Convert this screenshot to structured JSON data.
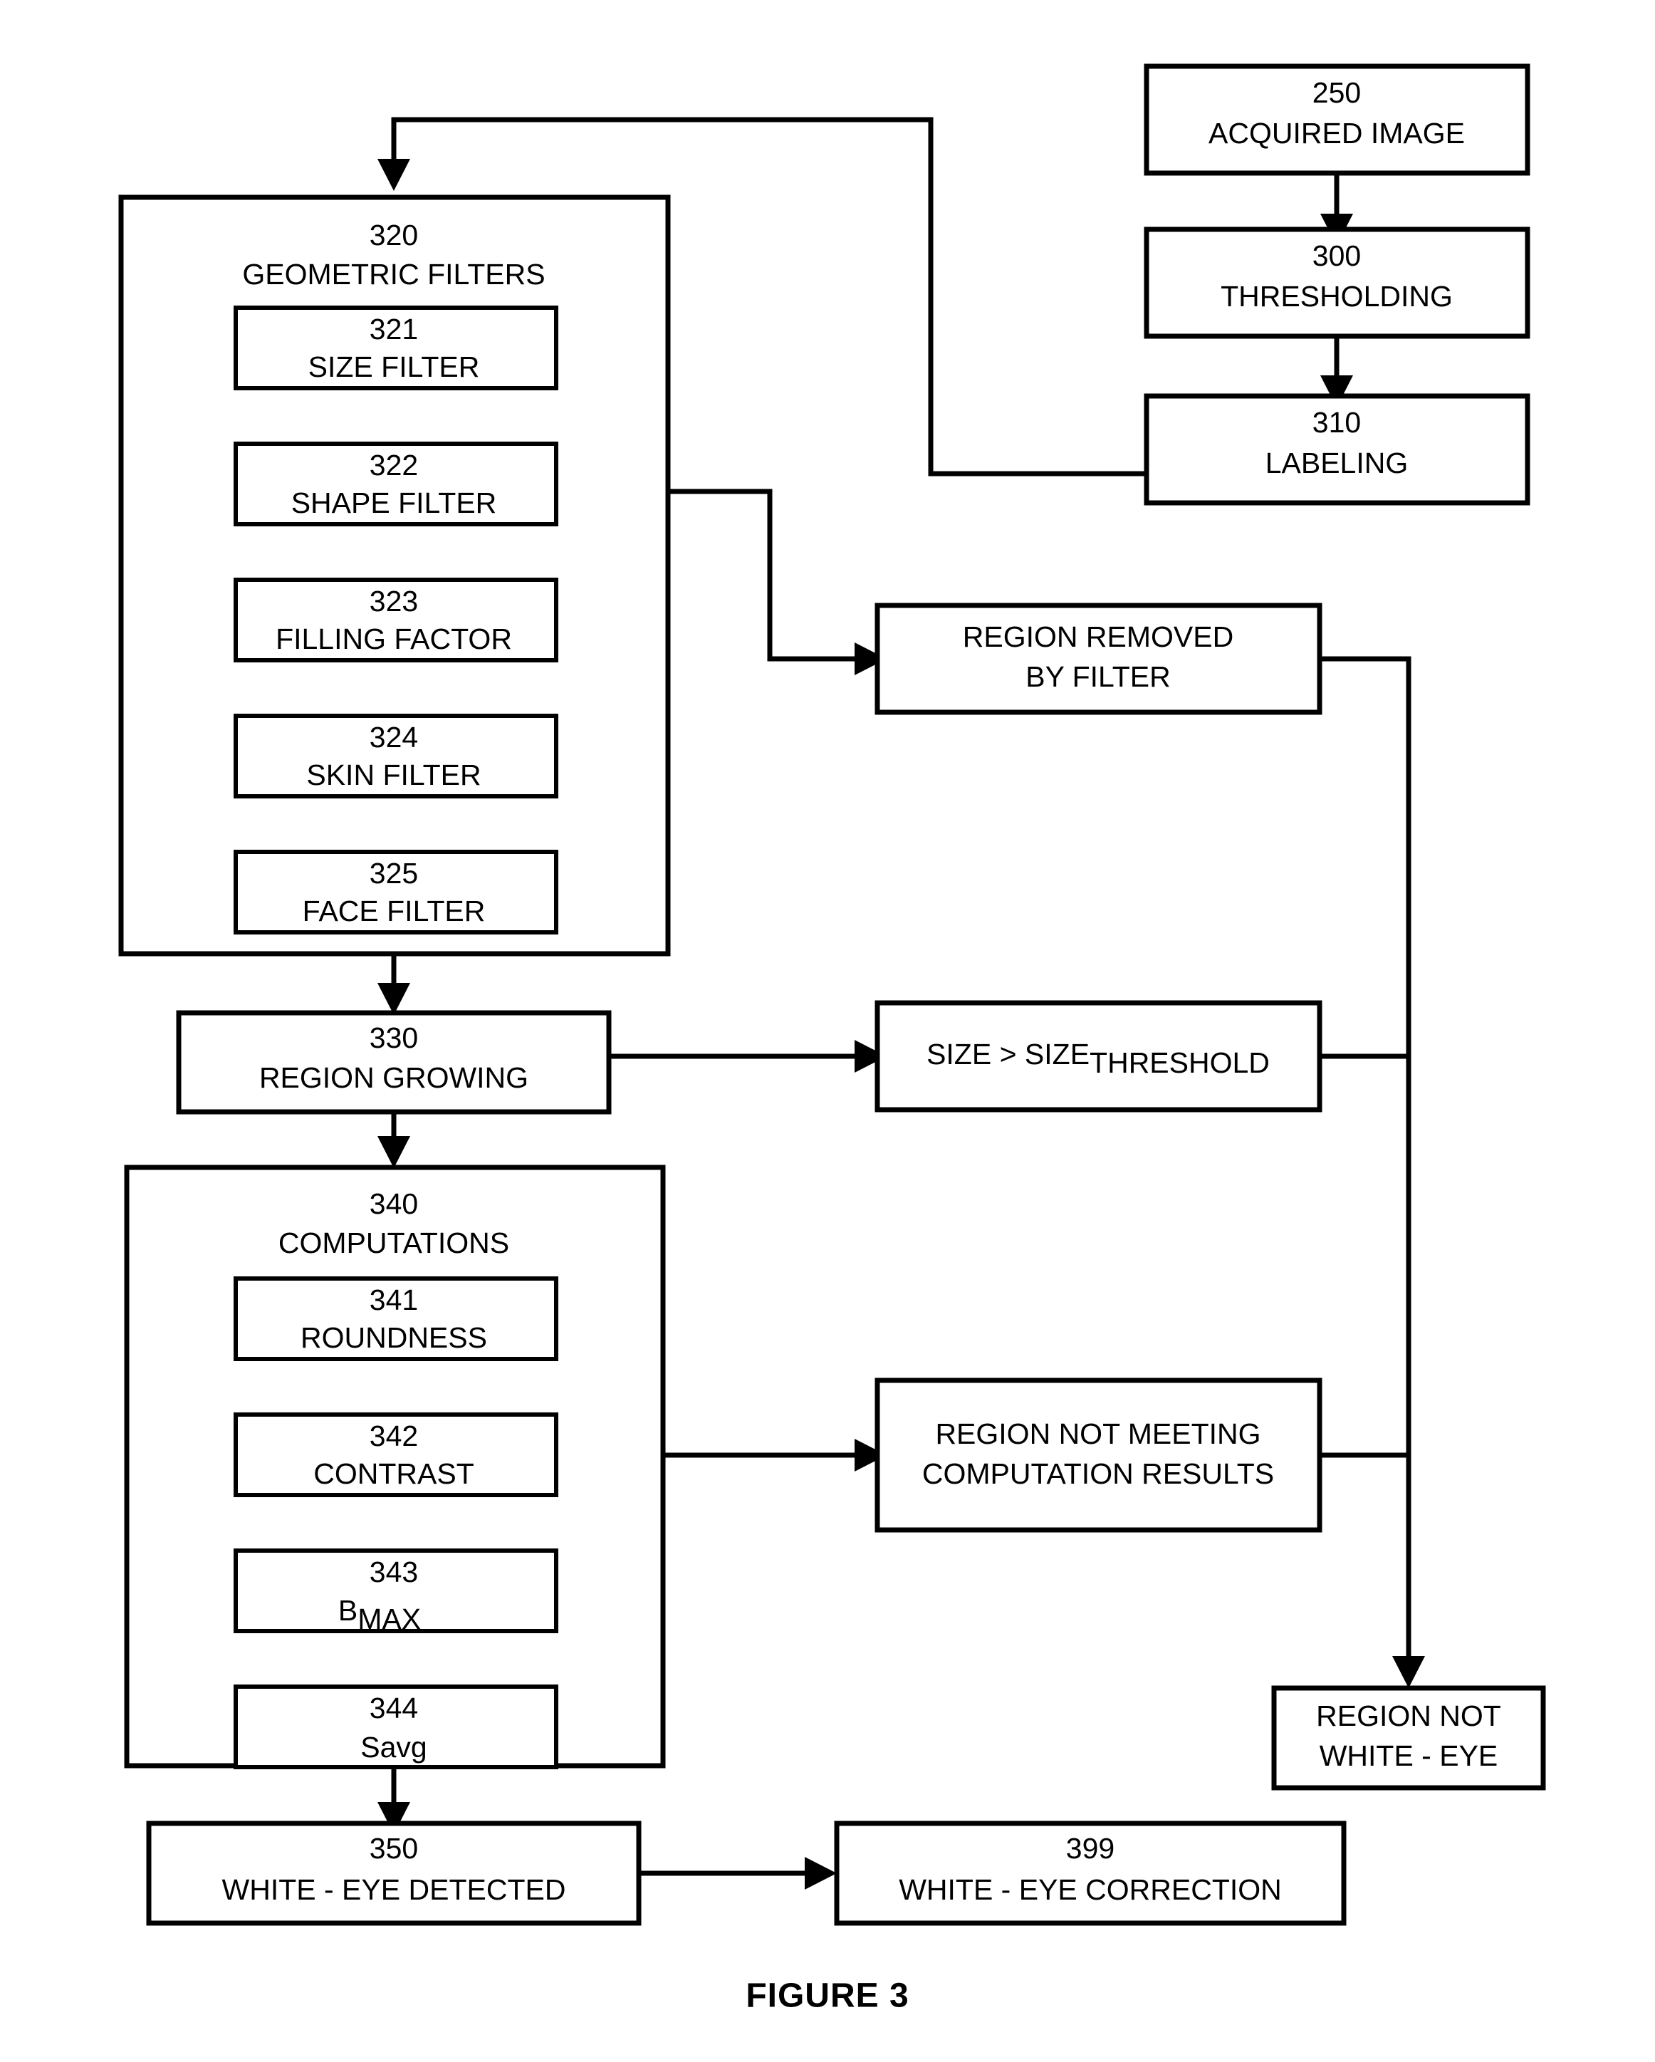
{
  "figure": {
    "caption": "FIGURE 3"
  },
  "nodes": {
    "acquired_image": {
      "number": "250",
      "label": "ACQUIRED IMAGE"
    },
    "thresholding": {
      "number": "300",
      "label": "THRESHOLDING"
    },
    "labeling": {
      "number": "310",
      "label": "LABELING"
    },
    "geometric_filters": {
      "number": "320",
      "label": "GEOMETRIC FILTERS"
    },
    "size_filter": {
      "number": "321",
      "label": "SIZE FILTER"
    },
    "shape_filter": {
      "number": "322",
      "label": "SHAPE FILTER"
    },
    "filling_factor": {
      "number": "323",
      "label": "FILLING FACTOR"
    },
    "skin_filter": {
      "number": "324",
      "label": "SKIN FILTER"
    },
    "face_filter": {
      "number": "325",
      "label": "FACE FILTER"
    },
    "region_growing": {
      "number": "330",
      "label": "REGION GROWING"
    },
    "computations": {
      "number": "340",
      "label": "COMPUTATIONS"
    },
    "roundness": {
      "number": "341",
      "label": "ROUNDNESS"
    },
    "contrast": {
      "number": "342",
      "label": "CONTRAST"
    },
    "bmax": {
      "number": "343",
      "label": "B",
      "label_subscript": "MAX"
    },
    "savg": {
      "number": "344",
      "label": "Savg"
    },
    "white_eye_detected": {
      "number": "350",
      "label": "WHITE - EYE DETECTED"
    },
    "white_eye_correction": {
      "number": "399",
      "label": "WHITE - EYE CORRECTION"
    },
    "region_removed": {
      "line1": "REGION REMOVED",
      "line2": "BY FILTER"
    },
    "size_threshold": {
      "label": "SIZE > SIZE",
      "label_subscript": "THRESHOLD"
    },
    "region_not_meeting": {
      "line1": "REGION NOT MEETING",
      "line2": "COMPUTATION RESULTS"
    },
    "region_not_white_eye": {
      "line1": "REGION NOT",
      "line2": "WHITE - EYE"
    }
  },
  "style": {
    "stroke_color": "#000000",
    "fill_color": "#ffffff",
    "background": "#ffffff"
  }
}
